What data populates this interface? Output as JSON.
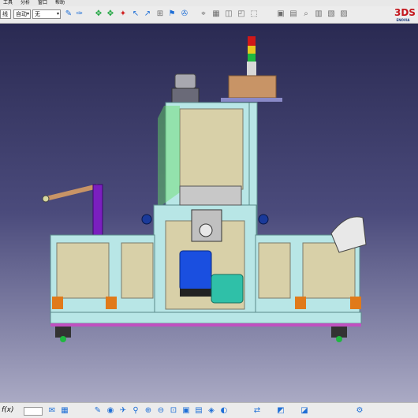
{
  "menubar": {
    "items": [
      {
        "label": "工具"
      },
      {
        "label": "分析"
      },
      {
        "label": "窗口"
      },
      {
        "label": "帮助"
      }
    ]
  },
  "toolbar": {
    "selects": [
      {
        "value": "线"
      },
      {
        "value": "自动"
      },
      {
        "value": "无"
      }
    ]
  },
  "brand": {
    "mark": "3DS",
    "name": "ENOVIA"
  },
  "statusbar": {
    "command_label": "f(x)",
    "command_value": ""
  },
  "colors": {
    "frame": "#b8e6e6",
    "panel": "#d8d0a8",
    "motor": "#1a4fe0",
    "pump": "#2fc0a8",
    "purple": "#7a1fbf",
    "background_top": "#2a2a52",
    "background_bottom": "#aaaac4"
  },
  "icons": {
    "toolbar": [
      "pencil-icon",
      "bucket-icon",
      "pan-icon",
      "rotate-icon",
      "zoom-icon",
      "pointer-icon",
      "measure-icon",
      "snap-icon",
      "filter-icon",
      "compass-icon",
      "axis-icon",
      "grid-icon",
      "layer-icon",
      "render-icon",
      "capture-icon"
    ],
    "statusbar": [
      "formula-icon",
      "chat-icon",
      "table-icon",
      "script-icon",
      "camera-icon",
      "fly-icon",
      "walk-icon",
      "zoom-in-icon",
      "zoom-out-icon",
      "fit-all-icon",
      "front-view-icon",
      "top-view-icon",
      "iso-view-icon",
      "hide-icon",
      "swap-icon",
      "shading-icon",
      "render-style-icon",
      "settings-icon"
    ]
  }
}
